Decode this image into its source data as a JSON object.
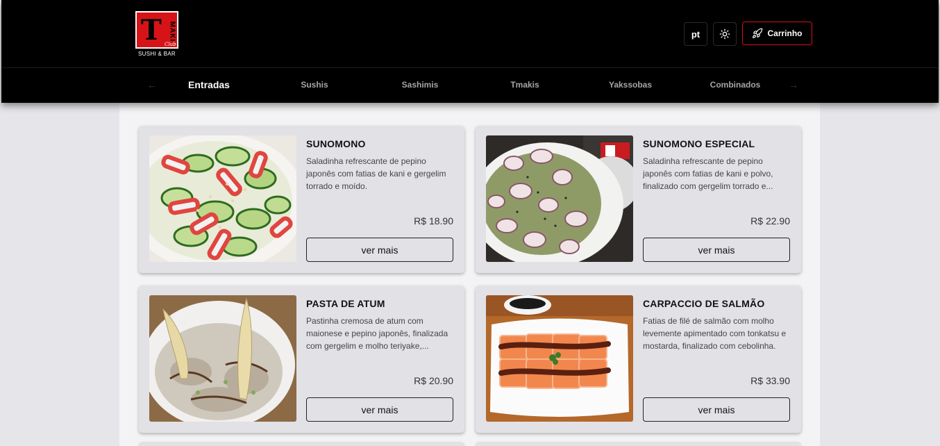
{
  "brand": {
    "logo_letter": "T",
    "logo_maki": "MAKI",
    "logo_club": "Club",
    "logo_text": "SUSHI & BAR"
  },
  "header": {
    "lang_label": "pt",
    "theme_icon": "sun-icon",
    "cart_icon": "rocket-icon",
    "cart_label": "Carrinho",
    "accent_color": "#d0141a"
  },
  "nav": {
    "prev_icon": "arrow-left-icon",
    "next_icon": "arrow-right-icon",
    "active_index": 0,
    "items": [
      "Entradas",
      "Sushis",
      "Sashimis",
      "Tmakis",
      "Yakssobas",
      "Combinados"
    ]
  },
  "products": [
    {
      "title": "SUNOMONO",
      "description": "Saladinha refrescante de pepino japonês com fatias de kani e gergelim torrado e moído.",
      "price": "R$ 18.90",
      "button": "ver mais"
    },
    {
      "title": "SUNOMONO ESPECIAL",
      "description": "Saladinha refrescante de pepino japonês com fatias de kani e polvo, finalizado com gergelim torrado e...",
      "price": "R$ 22.90",
      "button": "ver mais"
    },
    {
      "title": "PASTA DE ATUM",
      "description": "Pastinha cremosa de atum com maionese e pepino japonês, finalizada com gergelim e molho teriyake,...",
      "price": "R$ 20.90",
      "button": "ver mais"
    },
    {
      "title": "CARPACCIO DE SALMÃO",
      "description": "Fatias de filé de salmão com molho levemente apimentado com tonkatsu e mostarda, finalizado com cebolinha.",
      "price": "R$ 33.90",
      "button": "ver mais"
    }
  ]
}
